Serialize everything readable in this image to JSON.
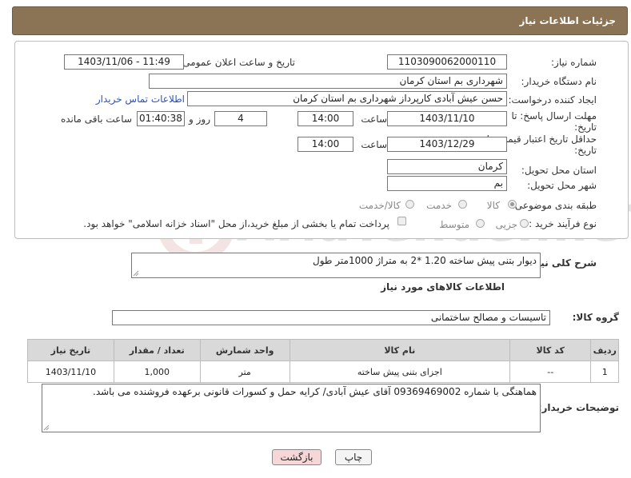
{
  "header": {
    "title": "جزئیات اطلاعات نیاز"
  },
  "form": {
    "need_number_label": "شماره نیاز:",
    "need_number": "1103090062000110",
    "announce_label": "تاریخ و ساعت اعلان عمومی:",
    "announce_value": "1403/11/06 - 11:49",
    "buyer_org_label": "نام دستگاه خریدار:",
    "buyer_org": "شهرداری بم استان کرمان",
    "requester_label": "ایجاد کننده درخواست:",
    "requester": "حسن عیش آبادی کارپرداز شهرداری بم استان کرمان",
    "contact_link": "اطلاعات تماس خریدار",
    "deadline_label_1": "مهلت ارسال پاسخ: تا",
    "deadline_label_2": "تاریخ:",
    "deadline_date": "1403/11/10",
    "time_label": "ساعت",
    "deadline_time": "14:00",
    "days_value": "4",
    "days_label": "روز و",
    "remaining_time": "01:40:38",
    "remaining_label": "ساعت باقی مانده",
    "validity_label_1": "حداقل تاریخ اعتبار قیمت: تا",
    "validity_label_2": "تاریخ:",
    "validity_date": "1403/12/29",
    "validity_time": "14:00",
    "province_label": "استان محل تحویل:",
    "province": "کرمان",
    "city_label": "شهر محل تحویل:",
    "city": "بم",
    "category_label": "طبقه بندی موضوعی:",
    "category_options": [
      "کالا",
      "خدمت",
      "کالا/خدمت"
    ],
    "process_label": "نوع فرآیند خرید :",
    "process_options": [
      "جزیی",
      "متوسط"
    ],
    "treasury_note": "پرداخت تمام یا بخشی از مبلغ خرید،از محل \"اسناد خزانه اسلامی\" خواهد بود."
  },
  "description": {
    "label": "شرح کلی نیاز:",
    "text": "دیوار بتنی پیش ساخته 1.20 *2  به متراژ 1000متر طول"
  },
  "goods": {
    "section_title": "اطلاعات کالاهای مورد نیاز",
    "group_label": "گروه کالا:",
    "group_value": "تاسیسات و مصالح ساختمانی",
    "columns": [
      "ردیف",
      "کد کالا",
      "نام کالا",
      "واحد شمارش",
      "تعداد / مقدار",
      "تاریخ نیاز"
    ],
    "rows": [
      [
        "1",
        "--",
        "اجزای بتنی پیش ساخته",
        "متر",
        "1,000",
        "1403/11/10"
      ]
    ]
  },
  "buyer_notes": {
    "label": "توضیحات خریدار:",
    "text": "هماهنگی با شماره 09369469002 آقای عیش آبادی/ کرایه حمل و کسورات قانونی برعهده فروشنده می باشد."
  },
  "buttons": {
    "print": "چاپ",
    "back": "بازگشت"
  },
  "watermark": {
    "text": "AriaTender.neT"
  },
  "colors": {
    "header_bg": "#8b7355",
    "link": "#2a52be",
    "back_btn_bg": "#f6d6d6"
  }
}
